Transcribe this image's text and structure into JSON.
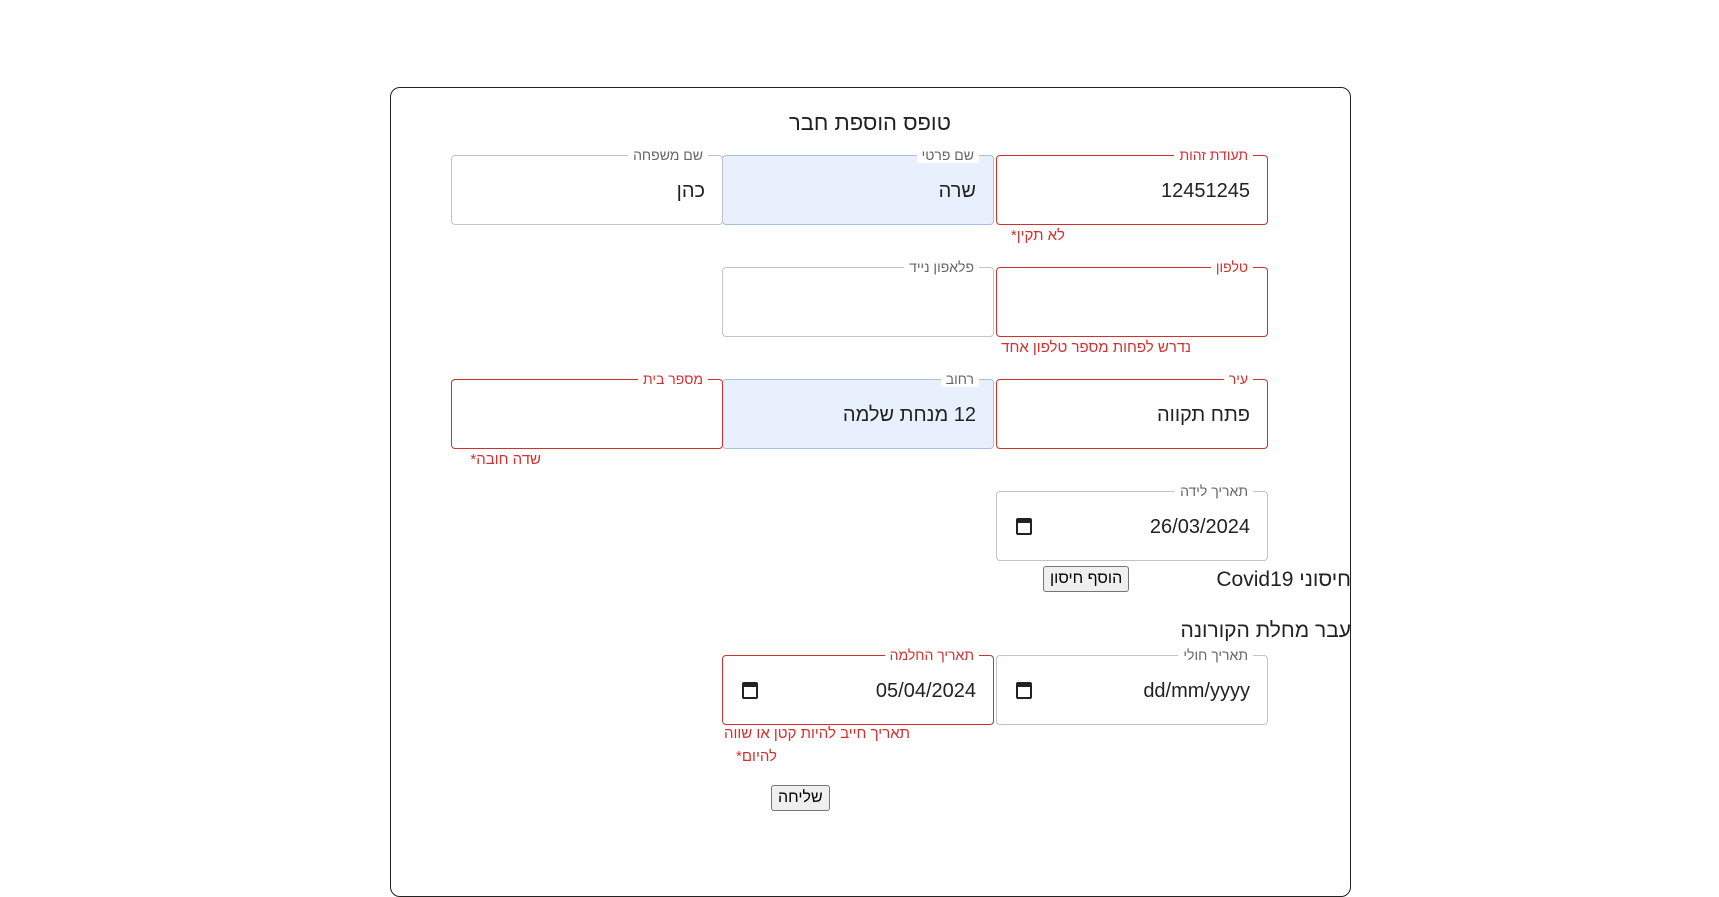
{
  "form": {
    "title": "טופס הוספת חבר",
    "fields": {
      "id_number": {
        "label": "תעודת זהות",
        "value": "12451245",
        "error": "לא תקין*"
      },
      "first_name": {
        "label": "שם פרטי",
        "value": "שרה"
      },
      "last_name": {
        "label": "שם משפחה",
        "value": "כהן"
      },
      "phone": {
        "label": "טלפון",
        "value": "",
        "error": "נדרש לפחות מספר טלפון אחד"
      },
      "mobile": {
        "label": "פלאפון נייד",
        "value": ""
      },
      "city": {
        "label": "עיר",
        "value": "פתח תקווה"
      },
      "street": {
        "label": "רחוב",
        "value": "12 מנחת שלמה"
      },
      "house_number": {
        "label": "מספר בית",
        "value": "",
        "error": "שדה חובה*"
      },
      "birth_date": {
        "label": "תאריך לידה",
        "value": "26/03/2024"
      },
      "illness_date": {
        "label": "תאריך חולי",
        "value": "dd/mm/yyyy"
      },
      "recovery_date": {
        "label": "תאריך החלמה",
        "value": "05/04/2024",
        "error_line1": "תאריך חייב להיות קטן או שווה",
        "error_line2": "להיום*"
      }
    },
    "vaccines": {
      "label": "חיסוני Covid19",
      "add_button": "הוסף חיסון"
    },
    "corona": {
      "label": "עבר מחלת הקורונה"
    },
    "submit_label": "שליחה"
  },
  "colors": {
    "error": "#d32f2f",
    "autofill_bg": "#e8f0fe",
    "border": "#c4c4c4"
  },
  "icons": [
    "calendar-icon"
  ]
}
